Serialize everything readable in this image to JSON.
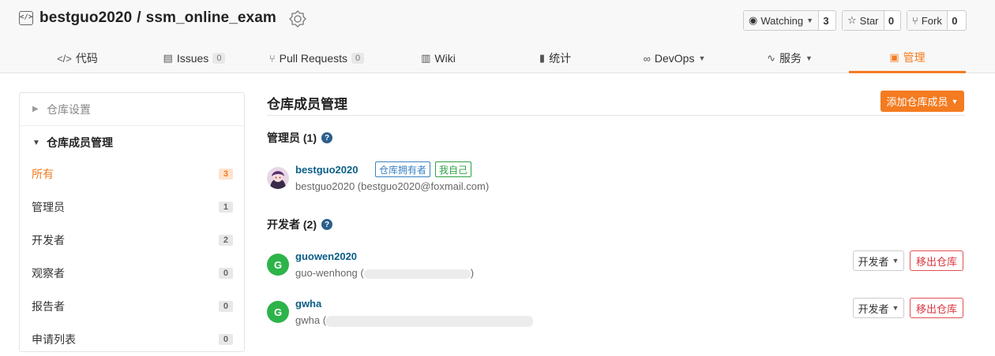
{
  "repo": {
    "owner": "bestguo2020",
    "separator": "/",
    "name": "ssm_online_exam"
  },
  "actions": {
    "watch": {
      "label": "Watching",
      "count": "3"
    },
    "star": {
      "label": "Star",
      "count": "0"
    },
    "fork": {
      "label": "Fork",
      "count": "0"
    }
  },
  "tabs": [
    {
      "icon": "</>",
      "label": "代码"
    },
    {
      "icon": "▤",
      "label": "Issues",
      "count": "0"
    },
    {
      "icon": "⑂",
      "label": "Pull Requests",
      "count": "0"
    },
    {
      "icon": "▥",
      "label": "Wiki"
    },
    {
      "icon": "▮",
      "label": "统计"
    },
    {
      "icon": "∞",
      "label": "DevOps"
    },
    {
      "icon": "∿",
      "label": "服务"
    },
    {
      "icon": "▣",
      "label": "管理"
    }
  ],
  "sidebar": {
    "group_settings": "仓库设置",
    "group_members": "仓库成员管理",
    "items": [
      {
        "label": "所有",
        "count": "3"
      },
      {
        "label": "管理员",
        "count": "1"
      },
      {
        "label": "开发者",
        "count": "2"
      },
      {
        "label": "观察者",
        "count": "0"
      },
      {
        "label": "报告者",
        "count": "0"
      },
      {
        "label": "申请列表",
        "count": "0"
      }
    ]
  },
  "main": {
    "title": "仓库成员管理",
    "add_button": "添加仓库成员",
    "admins_heading": "管理员 (1)",
    "developers_heading": "开发者 (2)",
    "help_glyph": "?",
    "admin": {
      "name": "bestguo2020",
      "tag_owner": "仓库拥有者",
      "tag_self": "我自己",
      "desc": "bestguo2020 (bestguo2020@foxmail.com)"
    },
    "developers": [
      {
        "initial": "G",
        "name": "guowen2020",
        "desc": "guo-wenhong (",
        "desc_end": ")",
        "role": "开发者",
        "remove": "移出仓库"
      },
      {
        "initial": "G",
        "name": "gwha",
        "desc": "gwha (",
        "role": "开发者",
        "remove": "移出仓库"
      }
    ]
  },
  "colors": {
    "accent": "#f47b20",
    "link": "#0a5e88",
    "danger": "#d9363e",
    "avatar_green": "#2db34a"
  }
}
